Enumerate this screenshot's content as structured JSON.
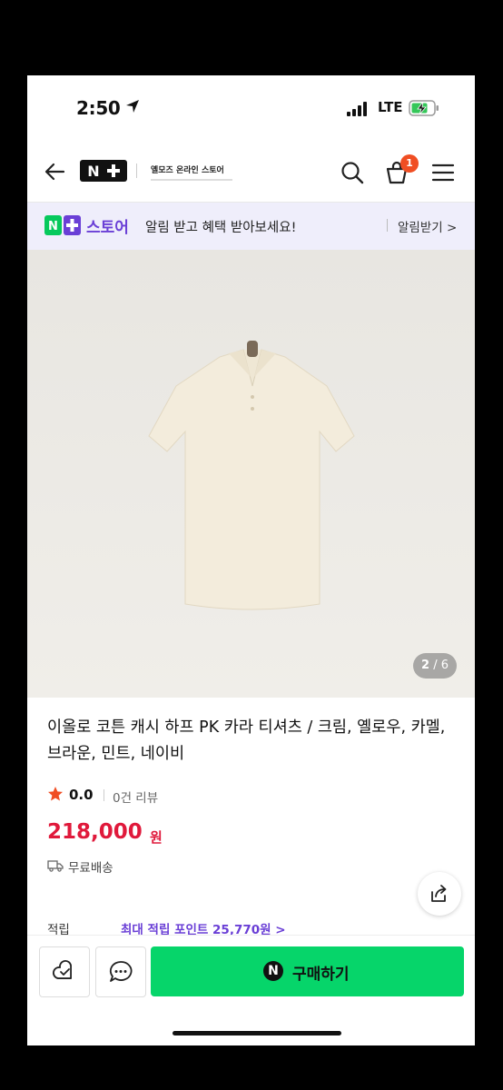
{
  "status_bar": {
    "time": "2:50",
    "network": "LTE"
  },
  "header": {
    "logo": "N+",
    "store_name": "옐모즈 온라인 스토어",
    "cart_count": "1"
  },
  "notice": {
    "store_label": "스토어",
    "text": "알림 받고 혜택 받아보세요!",
    "link": "알림받기 >"
  },
  "gallery": {
    "current": "2",
    "separator": "/",
    "total": "6"
  },
  "product": {
    "title": "이올로 코튼 캐시 하프 PK 카라 티셔츠 / 크림, 옐로우, 카멜, 브라운, 민트, 네이비",
    "rating": "0.0",
    "reviews": "0건 리뷰",
    "price": "218,000",
    "currency": "원",
    "shipping": "무료배송",
    "points_label": "적립",
    "points_value": "최대 적립 포인트 25,770원 >"
  },
  "actions": {
    "buy_label": "구매하기",
    "buy_badge": "N"
  },
  "colors": {
    "accent_purple": "#6a3fd6",
    "price_red": "#e0193b",
    "buy_green": "#06d56a",
    "badge_orange": "#f04e23"
  }
}
